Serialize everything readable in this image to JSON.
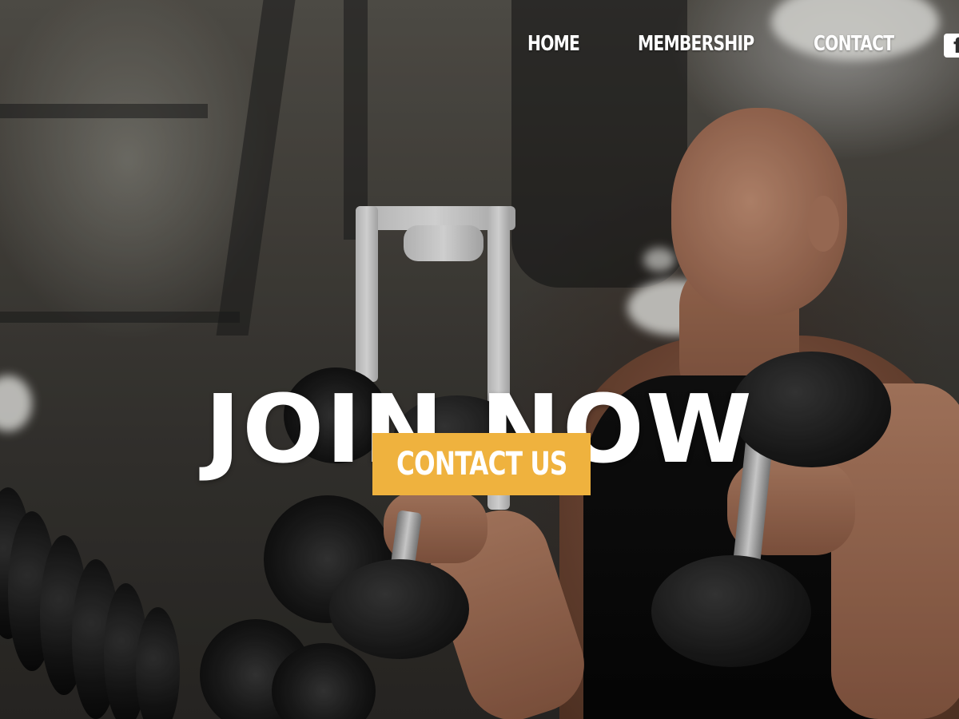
{
  "nav": {
    "items": [
      {
        "label": "HOME"
      },
      {
        "label": "MEMBERSHIP"
      },
      {
        "label": "CONTACT"
      }
    ],
    "social": {
      "icon": "facebook-icon",
      "glyph": "f"
    }
  },
  "hero": {
    "headline": "JOIN NOW",
    "cta_label": "CONTACT US"
  },
  "colors": {
    "accent": "#efb23e",
    "text": "#ffffff"
  }
}
